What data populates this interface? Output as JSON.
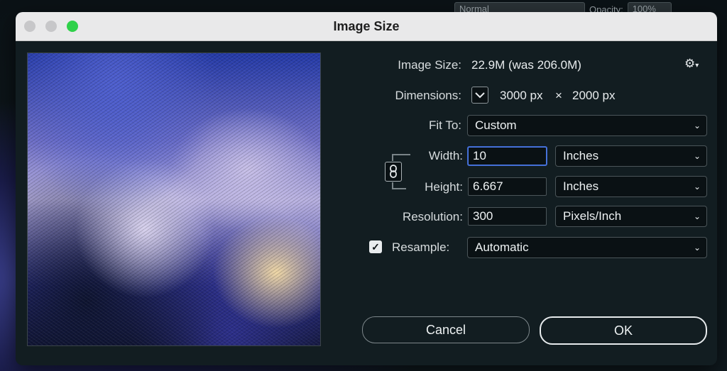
{
  "background": {
    "blend_mode": "Normal",
    "opacity_label": "Opacity:",
    "opacity_value": "100%"
  },
  "dialog": {
    "title": "Image Size",
    "traffic_colors": {
      "close": "#c7c7c9",
      "minimize": "#c7c7c9",
      "zoom": "#2fd14a"
    }
  },
  "image_size": {
    "label": "Image Size:",
    "value": "22.9M (was 206.0M)",
    "gear_icon": "gear-icon"
  },
  "dimensions": {
    "label": "Dimensions:",
    "width": "3000 px",
    "times": "×",
    "height": "2000 px"
  },
  "fit_to": {
    "label": "Fit To:",
    "selected": "Custom"
  },
  "width": {
    "label": "Width:",
    "value": "10",
    "unit": "Inches"
  },
  "height": {
    "label": "Height:",
    "value": "6.667",
    "unit": "Inches"
  },
  "resolution": {
    "label": "Resolution:",
    "value": "300",
    "unit": "Pixels/Inch"
  },
  "resample": {
    "label": "Resample:",
    "checked": true,
    "selected": "Automatic"
  },
  "buttons": {
    "cancel": "Cancel",
    "ok": "OK"
  },
  "colors": {
    "dialog_bg": "#121d21",
    "field_bg": "#0a1114",
    "focus_ring": "#4d7be8",
    "ok_border": "#e6eaec"
  }
}
